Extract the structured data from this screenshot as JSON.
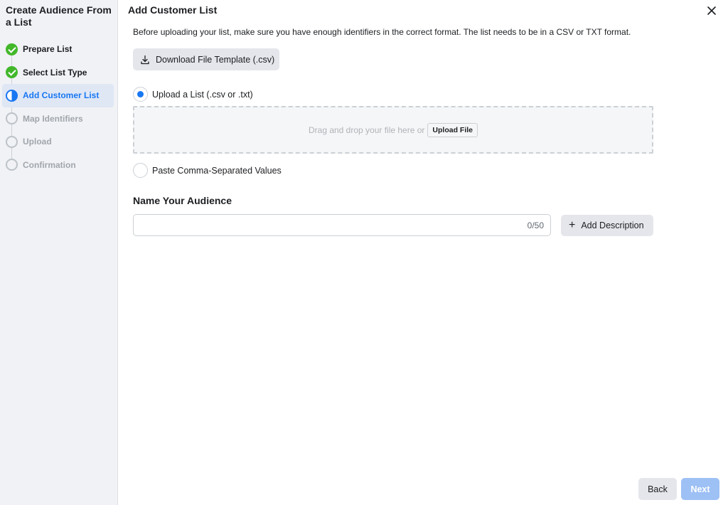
{
  "sidebar": {
    "title": "Create Audience From a List",
    "steps": [
      {
        "label": "Prepare List",
        "state": "done"
      },
      {
        "label": "Select List Type",
        "state": "done"
      },
      {
        "label": "Add Customer List",
        "state": "active"
      },
      {
        "label": "Map Identifiers",
        "state": "todo"
      },
      {
        "label": "Upload",
        "state": "todo"
      },
      {
        "label": "Confirmation",
        "state": "todo"
      }
    ]
  },
  "main": {
    "title": "Add Customer List",
    "close_icon": "close-icon",
    "intro": "Before uploading your list, make sure you have enough identifiers in the correct format. The list needs to be in a CSV or TXT format.",
    "download_button": {
      "label": "Download File Template (.csv)",
      "icon": "download-icon"
    },
    "upload_option": {
      "label": "Upload a List (.csv or .txt)",
      "checked": true
    },
    "dropzone": {
      "text": "Drag and drop your file here or",
      "button_label": "Upload File"
    },
    "paste_option": {
      "label": "Paste Comma-Separated Values",
      "checked": false
    },
    "name_section": {
      "label": "Name Your Audience",
      "value": "",
      "char_count": "0/50",
      "add_description_label": "Add Description"
    },
    "footer": {
      "back_label": "Back",
      "next_label": "Next"
    }
  },
  "colors": {
    "accent": "#1877f2",
    "success": "#42b72a",
    "next_disabled": "#9dc0f5"
  }
}
